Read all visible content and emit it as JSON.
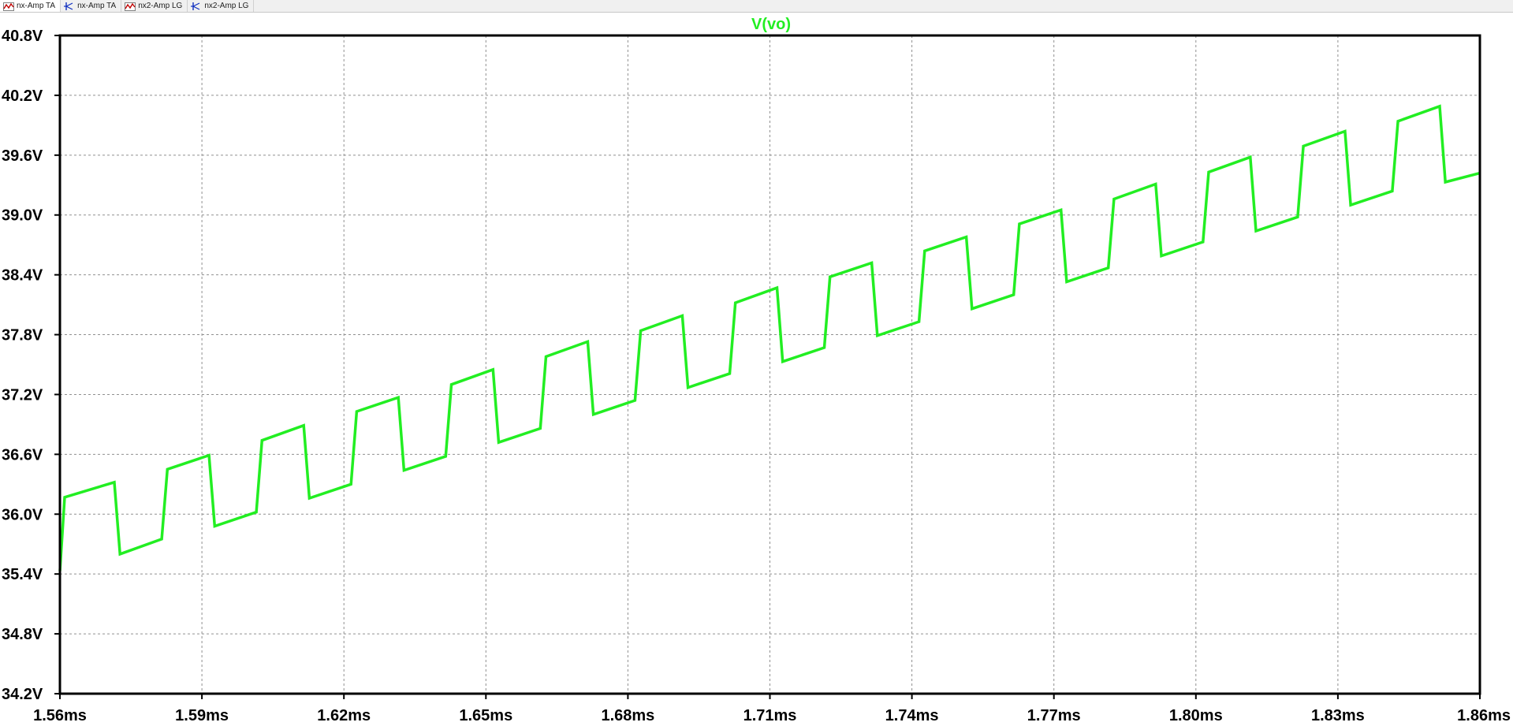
{
  "tabs": [
    {
      "label": "nx-Amp TA",
      "icon": "waveform-icon",
      "icon_color": "#c00000",
      "active": true
    },
    {
      "label": "nx-Amp TA",
      "icon": "schematic-icon",
      "icon_color": "#1030c0",
      "active": false
    },
    {
      "label": "nx2-Amp LG",
      "icon": "waveform-icon",
      "icon_color": "#c00000",
      "active": false
    },
    {
      "label": "nx2-Amp LG",
      "icon": "schematic-icon",
      "icon_color": "#1030c0",
      "active": false
    }
  ],
  "colors": {
    "trace": "#22ee22",
    "grid": "#909090",
    "frame": "#000000",
    "background": "#ffffff"
  },
  "chart_data": {
    "type": "line",
    "title": "V(vo)",
    "xlabel": "",
    "ylabel": "",
    "grid": true,
    "xlim": [
      1.56,
      1.86
    ],
    "ylim": [
      34.2,
      40.8
    ],
    "x_unit": "ms",
    "y_unit": "V",
    "x_ticks": [
      "1.56ms",
      "1.59ms",
      "1.62ms",
      "1.65ms",
      "1.68ms",
      "1.71ms",
      "1.74ms",
      "1.77ms",
      "1.80ms",
      "1.83ms",
      "1.86ms"
    ],
    "x_tick_values": [
      1.56,
      1.59,
      1.62,
      1.65,
      1.68,
      1.71,
      1.74,
      1.77,
      1.8,
      1.83,
      1.86
    ],
    "y_ticks": [
      "40.8V",
      "40.2V",
      "39.6V",
      "39.0V",
      "38.4V",
      "37.8V",
      "37.2V",
      "36.6V",
      "36.0V",
      "35.4V",
      "34.8V",
      "34.2V"
    ],
    "y_tick_values": [
      40.8,
      40.2,
      39.6,
      39.0,
      38.4,
      37.8,
      37.2,
      36.6,
      36.0,
      35.4,
      34.8,
      34.2
    ],
    "series": [
      {
        "name": "V(vo)",
        "x": [
          1.56,
          1.561,
          1.5715,
          1.5727,
          1.5815,
          1.5827,
          1.5915,
          1.5927,
          1.6015,
          1.6027,
          1.6115,
          1.6127,
          1.6215,
          1.6227,
          1.6315,
          1.6327,
          1.6415,
          1.6427,
          1.6515,
          1.6527,
          1.6615,
          1.6627,
          1.6715,
          1.6727,
          1.6815,
          1.6827,
          1.6915,
          1.6927,
          1.7015,
          1.7027,
          1.7115,
          1.7127,
          1.7215,
          1.7227,
          1.7315,
          1.7327,
          1.7415,
          1.7427,
          1.7515,
          1.7527,
          1.7615,
          1.7627,
          1.7715,
          1.7727,
          1.7815,
          1.7827,
          1.7915,
          1.7927,
          1.8015,
          1.8027,
          1.8115,
          1.8127,
          1.8215,
          1.8227,
          1.8315,
          1.8327,
          1.8415,
          1.8427,
          1.8515,
          1.8527,
          1.86
        ],
        "y": [
          35.43,
          36.17,
          36.32,
          35.6,
          35.75,
          36.45,
          36.59,
          35.88,
          36.02,
          36.74,
          36.89,
          36.16,
          36.3,
          37.03,
          37.17,
          36.44,
          36.58,
          37.3,
          37.45,
          36.72,
          36.86,
          37.58,
          37.73,
          37.0,
          37.14,
          37.84,
          37.99,
          37.27,
          37.41,
          38.12,
          38.27,
          37.53,
          37.67,
          38.38,
          38.52,
          37.79,
          37.93,
          38.64,
          38.78,
          38.06,
          38.2,
          38.91,
          39.05,
          38.33,
          38.47,
          39.16,
          39.31,
          38.59,
          38.73,
          39.43,
          39.58,
          38.84,
          38.98,
          39.69,
          39.84,
          39.1,
          39.24,
          39.94,
          40.09,
          39.33,
          39.42
        ]
      }
    ]
  }
}
